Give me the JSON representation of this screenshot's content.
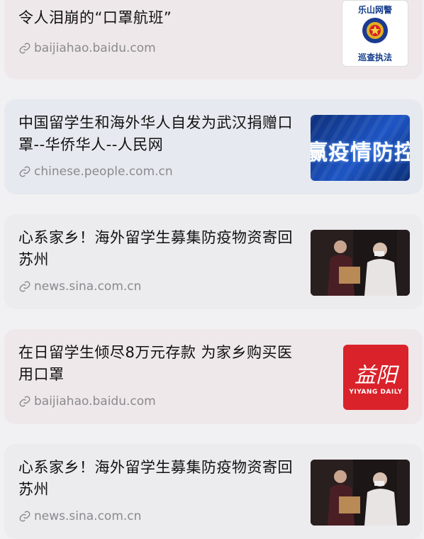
{
  "results": [
    {
      "title": "令人泪崩的“口罩航班”",
      "url": "baijiahao.baidu.com",
      "thumb_icon": "police-badge-icon",
      "thumb_text_top": "乐山网警",
      "thumb_text_bottom": "巡查执法"
    },
    {
      "title": "中国留学生和海外华人自发为武汉捐赠口罩--华侨华人--人民网",
      "url": "chinese.people.com.cn",
      "thumb_icon": "epidemic-banner-image",
      "thumb_text": "赢疫情防控"
    },
    {
      "title": "心系家乡！海外留学生募集防疫物资寄回苏州",
      "url": "news.sina.com.cn",
      "thumb_icon": "volunteers-photo-image"
    },
    {
      "title": "在日留学生倾尽8万元存款 为家乡购买医用口罩",
      "url": "baijiahao.baidu.com",
      "thumb_icon": "yiyang-daily-logo-icon",
      "thumb_text": "益阳",
      "thumb_subtext": "YIYANG DAILY"
    },
    {
      "title": "心系家乡！海外留学生募集防疫物资寄回苏州",
      "url": "news.sina.com.cn",
      "thumb_icon": "volunteers-photo-image"
    }
  ],
  "colors": {
    "card_pink": "#efe8ea",
    "card_blue": "#e6e9ef",
    "card_gray": "#ecebed",
    "accent_red": "#d9222a",
    "banner_blue": "#1d4fb5"
  }
}
